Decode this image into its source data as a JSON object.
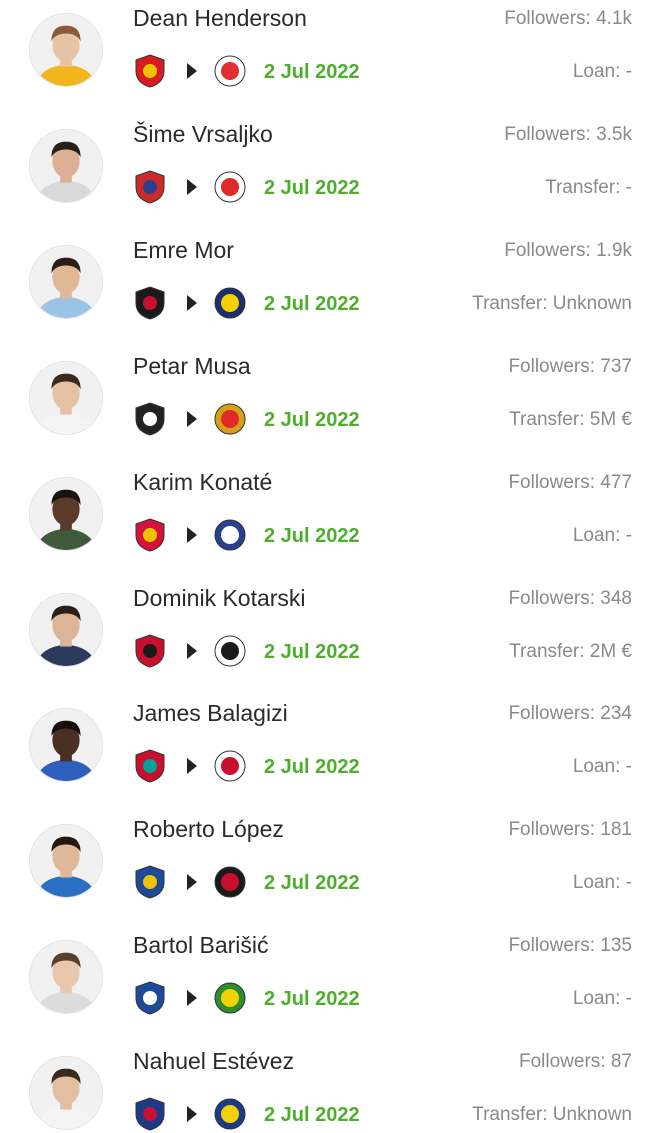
{
  "transfers": [
    {
      "player": "Dean Henderson",
      "followers": "Followers: 4.1k",
      "date": "2 Jul 2022",
      "transfer": "Loan: -",
      "from_crest": "manchester-united-crest-icon",
      "to_crest": "nottingham-forest-crest-icon",
      "from_colors": [
        "#d81b20",
        "#f2c200"
      ],
      "to_colors": [
        "#e03030",
        "#ffffff"
      ],
      "kit": "#f2b51c",
      "skin": "#e8c3a6",
      "hair": "#8a5a3a"
    },
    {
      "player": "Šime Vrsaljko",
      "followers": "Followers: 3.5k",
      "date": "2 Jul 2022",
      "transfer": "Transfer: -",
      "from_crest": "atletico-madrid-crest-icon",
      "to_crest": "olympiacos-crest-icon",
      "from_colors": [
        "#cb2a2a",
        "#2a3f8f"
      ],
      "to_colors": [
        "#e02a2a",
        "#ffffff"
      ],
      "kit": "#d9d9d9",
      "skin": "#dcb094",
      "hair": "#2b2017"
    },
    {
      "player": "Emre Mor",
      "followers": "Followers: 1.9k",
      "date": "2 Jul 2022",
      "transfer": "Transfer: Unknown",
      "from_crest": "fatih-karagumruk-crest-icon",
      "to_crest": "fenerbahce-crest-icon",
      "from_colors": [
        "#1a1a1a",
        "#c8102e"
      ],
      "to_colors": [
        "#f4d200",
        "#1b2f6e"
      ],
      "kit": "#9ac4e4",
      "skin": "#dfb896",
      "hair": "#2a1f18"
    },
    {
      "player": "Petar Musa",
      "followers": "Followers: 737",
      "date": "2 Jul 2022",
      "transfer": "Transfer: 5M €",
      "from_crest": "boavista-crest-icon",
      "to_crest": "benfica-crest-icon",
      "from_colors": [
        "#222222",
        "#ffffff"
      ],
      "to_colors": [
        "#e02a2a",
        "#d4a017"
      ],
      "kit": "#f4f4f4",
      "skin": "#e6c2a5",
      "hair": "#3b2a20"
    },
    {
      "player": "Karim Konaté",
      "followers": "Followers: 477",
      "date": "2 Jul 2022",
      "transfer": "Loan: -",
      "from_crest": "rb-salzburg-crest-icon",
      "to_crest": "fc-liefering-crest-icon",
      "from_colors": [
        "#d4123c",
        "#f2c200"
      ],
      "to_colors": [
        "#ffffff",
        "#2a3f8f"
      ],
      "kit": "#3f5a3a",
      "skin": "#5a3a28",
      "hair": "#1a1410"
    },
    {
      "player": "Dominik Kotarski",
      "followers": "Followers: 348",
      "date": "2 Jul 2022",
      "transfer": "Transfer: 2M €",
      "from_crest": "hnk-gorica-crest-icon",
      "to_crest": "paok-crest-icon",
      "from_colors": [
        "#c8102e",
        "#1a1a1a"
      ],
      "to_colors": [
        "#1a1a1a",
        "#ffffff"
      ],
      "kit": "#2b3b5b",
      "skin": "#dcb497",
      "hair": "#2a2018"
    },
    {
      "player": "James Balagizi",
      "followers": "Followers: 234",
      "date": "2 Jul 2022",
      "transfer": "Loan: -",
      "from_crest": "liverpool-crest-icon",
      "to_crest": "crawley-town-crest-icon",
      "from_colors": [
        "#c8102e",
        "#00a398"
      ],
      "to_colors": [
        "#c8102e",
        "#ffffff"
      ],
      "kit": "#2e5fbf",
      "skin": "#4b2f22",
      "hair": "#15100c"
    },
    {
      "player": "Roberto López",
      "followers": "Followers: 181",
      "date": "2 Jul 2022",
      "transfer": "Loan: -",
      "from_crest": "real-sociedad-crest-icon",
      "to_crest": "cd-mirandes-crest-icon",
      "from_colors": [
        "#1d4b9a",
        "#f2c200"
      ],
      "to_colors": [
        "#c8102e",
        "#1a1a1a"
      ],
      "kit": "#2a6fc4",
      "skin": "#dfb899",
      "hair": "#22180f"
    },
    {
      "player": "Bartol Barišić",
      "followers": "Followers: 135",
      "date": "2 Jul 2022",
      "transfer": "Loan: -",
      "from_crest": "dinamo-zagreb-crest-icon",
      "to_crest": "nk-istra-crest-icon",
      "from_colors": [
        "#1d4b9a",
        "#ffffff"
      ],
      "to_colors": [
        "#f2d200",
        "#2e8b2e"
      ],
      "kit": "#dcdcdc",
      "skin": "#e9c7ac",
      "hair": "#5a3f2a"
    },
    {
      "player": "Nahuel Estévez",
      "followers": "Followers: 87",
      "date": "2 Jul 2022",
      "transfer": "Transfer: Unknown",
      "from_crest": "crotone-crest-icon",
      "to_crest": "parma-crest-icon",
      "from_colors": [
        "#1d3a8a",
        "#c8102e"
      ],
      "to_colors": [
        "#f2d200",
        "#1d3a8a"
      ],
      "kit": "#f4f4f4",
      "skin": "#e3bfa2",
      "hair": "#3a2a1e"
    }
  ]
}
